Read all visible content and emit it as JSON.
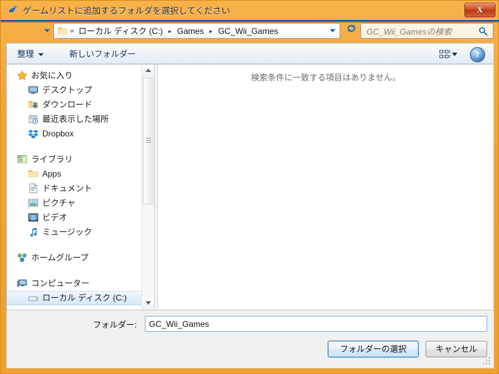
{
  "window": {
    "title": "ゲームリストに追加するフォルダを選択してください",
    "title_icon": "dolphin-icon",
    "close_label": "X",
    "frame_color": "#f0a031",
    "accent_color": "#3c7fb1"
  },
  "nav": {
    "back_glyph": "◀",
    "forward_glyph": "▶",
    "refresh_glyph": "↻",
    "breadcrumb": {
      "chevron": "«",
      "separator": "▸",
      "items": [
        "ローカル ディスク (C:)",
        "Games",
        "GC_Wii_Games"
      ]
    },
    "search": {
      "placeholder": "GC_Wii_Gamesの検索",
      "icon": "search-icon"
    }
  },
  "toolbar": {
    "organize_label": "整理",
    "new_folder_label": "新しいフォルダー",
    "views_icon": "view-options-icon",
    "help_label": "?"
  },
  "sidebar": {
    "groups": [
      {
        "header": {
          "label": "お気に入り",
          "icon": "star-icon"
        },
        "items": [
          {
            "label": "デスクトップ",
            "icon": "desktop-icon"
          },
          {
            "label": "ダウンロード",
            "icon": "downloads-icon"
          },
          {
            "label": "最近表示した場所",
            "icon": "recent-places-icon"
          },
          {
            "label": "Dropbox",
            "icon": "dropbox-icon"
          }
        ]
      },
      {
        "header": {
          "label": "ライブラリ",
          "icon": "libraries-icon"
        },
        "items": [
          {
            "label": "Apps",
            "icon": "folder-icon"
          },
          {
            "label": "ドキュメント",
            "icon": "documents-icon"
          },
          {
            "label": "ピクチャ",
            "icon": "pictures-icon"
          },
          {
            "label": "ビデオ",
            "icon": "videos-icon"
          },
          {
            "label": "ミュージック",
            "icon": "music-icon"
          }
        ]
      },
      {
        "header": {
          "label": "ホームグループ",
          "icon": "homegroup-icon"
        },
        "items": []
      },
      {
        "header": {
          "label": "コンピューター",
          "icon": "computer-icon"
        },
        "items": [
          {
            "label": "ローカル ディスク (C:)",
            "icon": "drive-icon",
            "selected": true
          }
        ]
      }
    ]
  },
  "content": {
    "empty_message": "検索条件に一致する項目はありません。"
  },
  "bottom": {
    "folder_label": "フォルダー:",
    "folder_value": "GC_Wii_Games",
    "select_button": "フォルダーの選択",
    "cancel_button": "キャンセル"
  }
}
